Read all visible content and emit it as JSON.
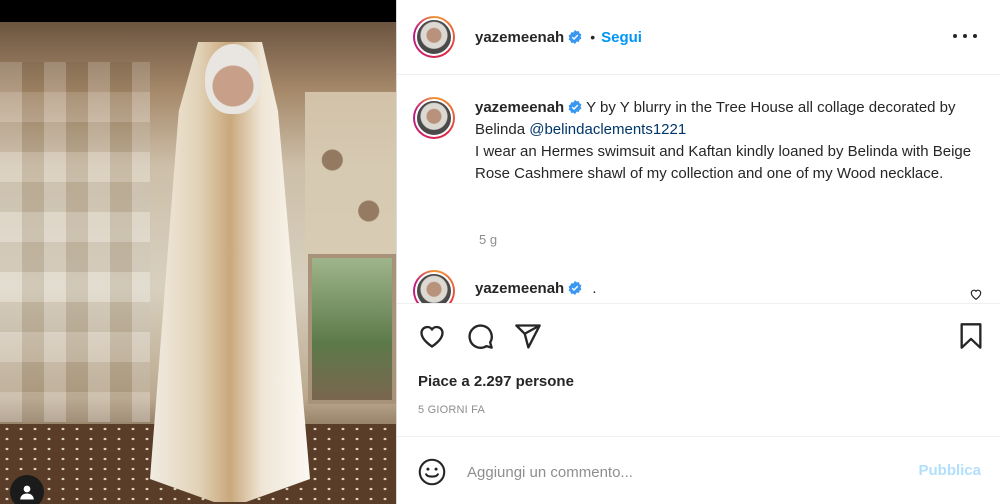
{
  "post": {
    "username": "yazemeenah",
    "follow_label": "Segui",
    "separator": "•",
    "verified_icon": "verified-badge-icon",
    "more_icon": "more-options-icon"
  },
  "caption": {
    "username": "yazemeenah",
    "text_before_mention": "Y by Y blurry in the Tree House all collage decorated by Belinda ",
    "mention": "@belindaclements1221",
    "text_after_mention": "I wear an Hermes swimsuit and Kaftan kindly loaned by Belinda with Beige Rose Cashmere shawl of my collection and one of my Wood necklace.",
    "time": "5 g"
  },
  "comment": {
    "username": "yazemeenah",
    "text": "."
  },
  "actions": {
    "like_icon": "heart-icon",
    "comment_icon": "comment-icon",
    "share_icon": "share-icon",
    "save_icon": "bookmark-icon"
  },
  "likes_text": "Piace a 2.297 persone",
  "posted_ago": "5 GIORNI FA",
  "add_comment": {
    "placeholder": "Aggiungi un commento...",
    "publish_label": "Pubblica",
    "emoji_icon": "emoji-icon"
  },
  "colors": {
    "link": "#0095f6",
    "mention": "#00376b",
    "publish_disabled": "#b2dffc",
    "text": "#262626",
    "muted": "#8e8e8e"
  }
}
